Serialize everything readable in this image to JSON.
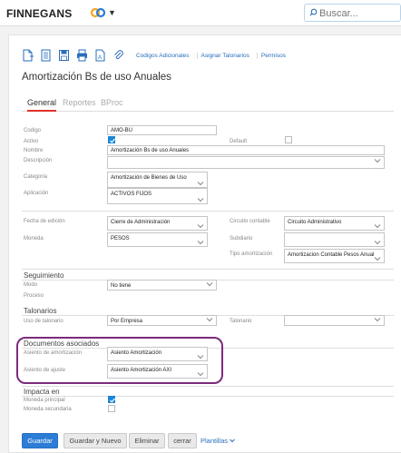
{
  "header": {
    "brand": "FINNEGANS",
    "search_placeholder": "Buscar..."
  },
  "toolbar": {
    "links": [
      "Codigos Adicionales",
      "Asignar Talonarios",
      "Permisos"
    ]
  },
  "page": {
    "title": "Amortización Bs de uso Anuales"
  },
  "tabs": [
    "General",
    "Reportes",
    "BProc"
  ],
  "general": {
    "codigo_label": "Codigo",
    "codigo_value": "AMO-BU",
    "activo_label": "Activo",
    "activo_checked": true,
    "default_label": "Default",
    "default_checked": false,
    "nombre_label": "Nombre",
    "nombre_value": "Amortización Bs de uso Anuales",
    "descripcion_label": "Descripción",
    "descripcion_value": "",
    "categoria_label": "Categoria",
    "categoria_value": "Amortización de Bienes de Uso",
    "aplicacion_label": "Aplicación",
    "aplicacion_value": "ACTIVOS FIJOS"
  },
  "contable": {
    "fecha_label": "Fecha de edición",
    "fecha_value": "Cierre de Administración",
    "circuito_label": "Circuito contable",
    "circuito_value": "Circuito Administrativo",
    "moneda_label": "Moneda",
    "moneda_value": "PESOS",
    "subdiario_label": "Subdiario",
    "subdiario_value": "",
    "tipo_label": "Tipo amortización",
    "tipo_value": "Amortizacion Contable Pesos Anual"
  },
  "seguimiento": {
    "title": "Seguimiento",
    "modo_label": "Modo",
    "modo_value": "No tiene",
    "proceso_label": "Proceso"
  },
  "talonarios": {
    "title": "Talonarios",
    "uso_label": "Uso de talonario",
    "uso_value": "Por Empresa",
    "talonario_label": "Talonario",
    "talonario_value": ""
  },
  "documentos": {
    "title": "Documentos asociados",
    "asiento_amort_label": "Asiento de amortización",
    "asiento_amort_value": "Asiento Amortización",
    "asiento_ajuste_label": "Asiento de ajuste",
    "asiento_ajuste_value": "Asiento Amortización AXI"
  },
  "impacta": {
    "title": "Impacta en",
    "principal_label": "Moneda principal",
    "principal_checked": true,
    "secundaria_label": "Moneda secundaria",
    "secundaria_checked": false
  },
  "actions": {
    "guardar": "Guardar",
    "guardar_nuevo": "Guardar y Nuevo",
    "eliminar": "Eliminar",
    "cerrar": "cerrar",
    "plantillas": "Plantillas"
  },
  "colors": {
    "primary": "#2d7dd6",
    "tab_active": "#e0322a",
    "highlight": "#7b2a7d"
  }
}
